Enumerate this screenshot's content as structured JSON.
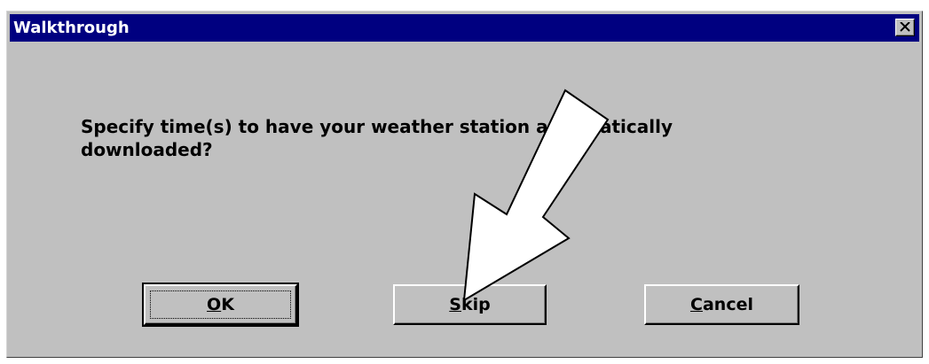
{
  "window": {
    "title": "Walkthrough"
  },
  "message": {
    "line1": "Specify time(s) to have your weather station automatically",
    "line2": "downloaded?"
  },
  "buttons": {
    "ok": {
      "mnemonic": "O",
      "rest": "K"
    },
    "skip": {
      "mnemonic": "S",
      "rest": "kip"
    },
    "cancel": {
      "mnemonic": "C",
      "rest": "ancel"
    }
  },
  "icons": {
    "close": "close-icon",
    "annotation": "arrow-icon"
  },
  "colors": {
    "titlebar": "#000080",
    "dialog_face": "#c0c0c0",
    "title_text": "#ffffff"
  }
}
